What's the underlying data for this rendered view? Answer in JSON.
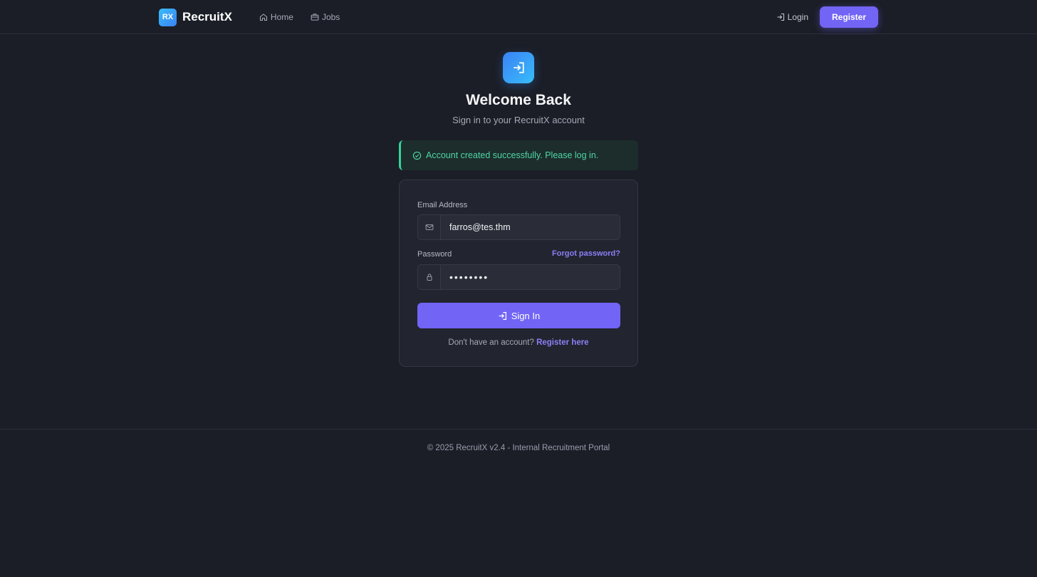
{
  "header": {
    "logo_text": "RX",
    "brand": "RecruitX",
    "nav": [
      {
        "label": "Home",
        "icon": "home-icon"
      },
      {
        "label": "Jobs",
        "icon": "briefcase-icon"
      }
    ],
    "login_label": "Login",
    "register_label": "Register"
  },
  "hero": {
    "icon": "sign-in-icon",
    "title": "Welcome Back",
    "subtitle": "Sign in to your RecruitX account"
  },
  "alert": {
    "icon": "check-circle-icon",
    "message": "Account created successfully. Please log in."
  },
  "form": {
    "email_label": "Email Address",
    "email_value": "farros@tes.thm",
    "password_label": "Password",
    "forgot_label": "Forgot password?",
    "password_value": "password",
    "submit_label": "Sign In",
    "register_prompt": "Don't have an account?",
    "register_link": "Register here"
  },
  "footer": {
    "text": "© 2025 RecruitX v2.4 - Internal Recruitment Portal"
  },
  "colors": {
    "background": "#1b1e27",
    "accent": "#7264f5",
    "success": "#34d399",
    "link": "#8b7ff7"
  }
}
